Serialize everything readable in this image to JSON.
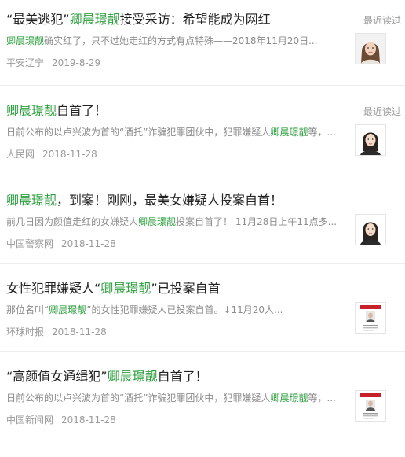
{
  "articles": [
    {
      "title_pre": "“最美逃犯”",
      "title_hl": "卿晨璟靓",
      "title_post": "接受采访：希望能成为网红",
      "recent": "最近读过",
      "snippet_pre": "",
      "snippet_hl": "卿晨璟靓",
      "snippet_post": "确实红了，只不过她走红的方式有点特殊——2018年11月20日...",
      "source": "平安辽宁",
      "date": "2019-8-29",
      "thumb_icon": "portrait-photo-icon"
    },
    {
      "title_pre": "",
      "title_hl": "卿晨璟靓",
      "title_post": "自首了！",
      "recent": "最近读过",
      "snippet_pre": "日前公布的以卢兴波为首的“酒托”诈骗犯罪团伙中，犯罪嫌疑人",
      "snippet_hl": "卿晨璟靓",
      "snippet_post": "等，...",
      "source": "人民网",
      "date": "2018-11-28",
      "thumb_icon": "portrait-photo-icon"
    },
    {
      "title_pre": "",
      "title_hl": "卿晨璟靓",
      "title_post": "，到案！刚刚，最美女嫌疑人投案自首！",
      "recent": "",
      "snippet_pre": "前几日因为颜值走红的女嫌疑人",
      "snippet_hl": "卿晨璟靓",
      "snippet_post": "投案自首了！ 11月28日上午11点多...",
      "source": "中国警察网",
      "date": "2018-11-28",
      "thumb_icon": "portrait-photo-icon"
    },
    {
      "title_pre": "女性犯罪嫌疑人“",
      "title_hl": "卿晨璟靓",
      "title_post": "”已投案自首",
      "recent": "",
      "snippet_pre": "那位名叫“",
      "snippet_hl": "卿晨璟靓",
      "snippet_post": "”的女性犯罪嫌疑人已投案自首。↓11月20人...",
      "source": "环球时报",
      "date": "2018-11-28",
      "thumb_icon": "wanted-poster-icon"
    },
    {
      "title_pre": "“高颜值女通缉犯”",
      "title_hl": "卿晨璟靓",
      "title_post": "自首了！",
      "recent": "",
      "snippet_pre": "日前公布的以卢兴波为首的“酒托”诈骗犯罪团伙中，犯罪嫌疑人",
      "snippet_hl": "卿晨璟靓",
      "snippet_post": "等，...",
      "source": "中国新闻网",
      "date": "2018-11-28",
      "thumb_icon": "wanted-poster-icon"
    }
  ],
  "colors": {
    "highlight": "#2c9f3e",
    "muted": "#9a9a9a",
    "text": "#222222"
  }
}
